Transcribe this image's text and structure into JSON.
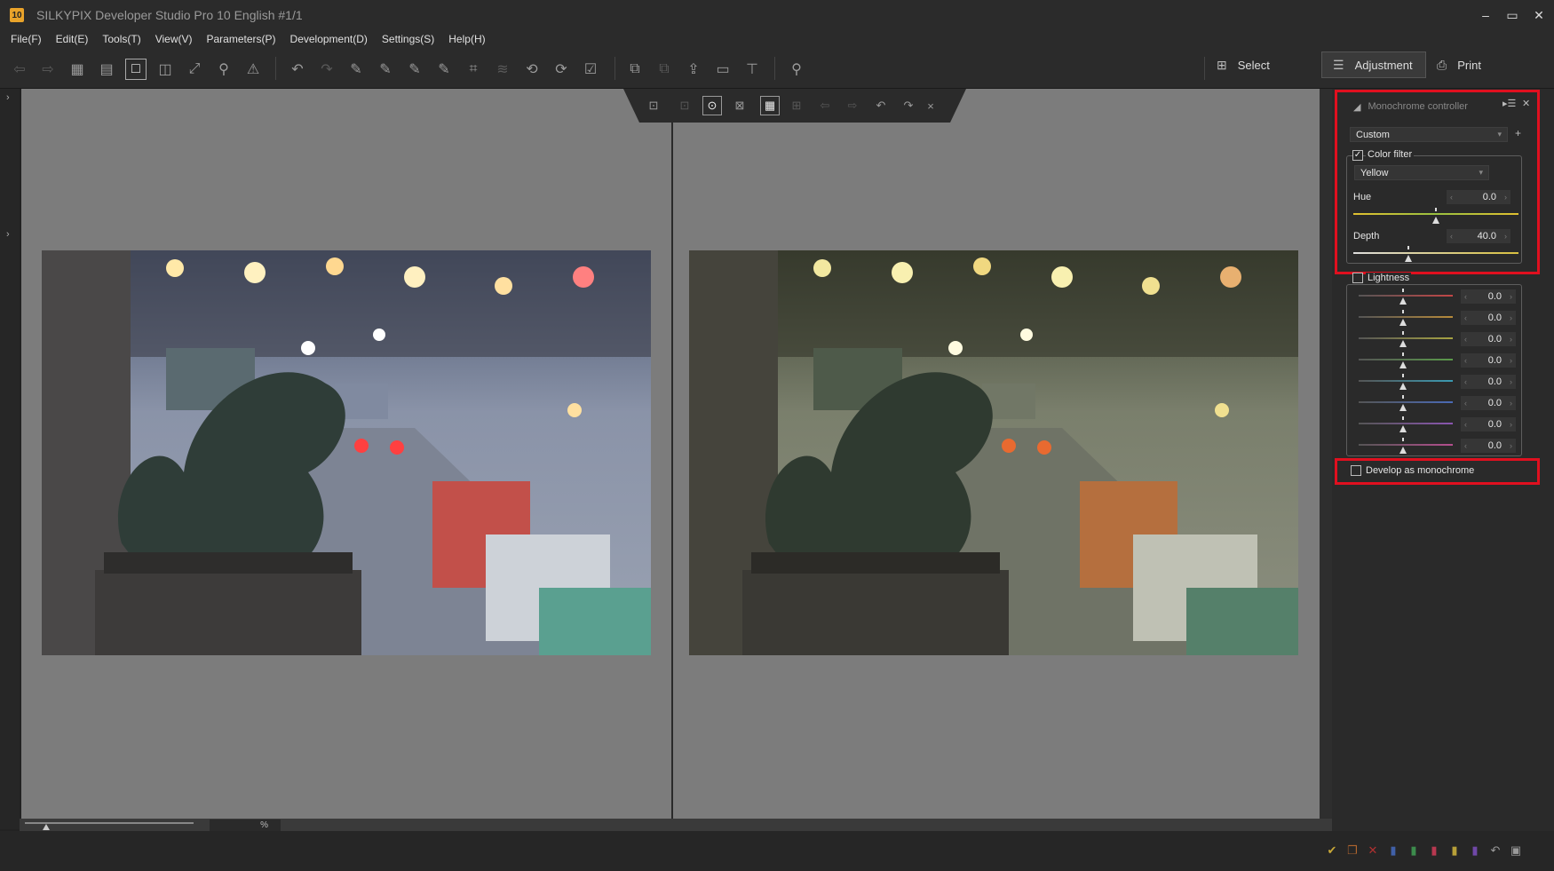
{
  "app": {
    "icon_text": "10",
    "title": "SILKYPIX Developer Studio Pro 10 English   #1/1"
  },
  "window_controls": {
    "minimize": "–",
    "maximize": "▭",
    "close": "✕"
  },
  "menu": [
    "File(F)",
    "Edit(E)",
    "Tools(T)",
    "View(V)",
    "Parameters(P)",
    "Development(D)",
    "Settings(S)",
    "Help(H)"
  ],
  "modes": {
    "select": "Select",
    "adjustment": "Adjustment",
    "print": "Print"
  },
  "zoom": {
    "value": "",
    "unit": "%"
  },
  "panel": {
    "title": "Monochrome controller",
    "preset": "Custom",
    "preset_add": "+",
    "color_filter": {
      "label": "Color filter",
      "checked": true,
      "color": "Yellow",
      "hue": {
        "label": "Hue",
        "value": "0.0"
      },
      "depth": {
        "label": "Depth",
        "value": "40.0"
      }
    },
    "lightness": {
      "label": "Lightness",
      "checked": false,
      "rows": [
        {
          "value": "0.0",
          "color": "#c24646"
        },
        {
          "value": "0.0",
          "color": "#b78a3a"
        },
        {
          "value": "0.0",
          "color": "#a7a342"
        },
        {
          "value": "0.0",
          "color": "#5a9a4a"
        },
        {
          "value": "0.0",
          "color": "#3a9ab2"
        },
        {
          "value": "0.0",
          "color": "#4a6ab6"
        },
        {
          "value": "0.0",
          "color": "#8a55b0"
        },
        {
          "value": "0.0",
          "color": "#b44e8e"
        }
      ]
    },
    "develop_mono": {
      "label": "Develop as monochrome",
      "checked": false
    }
  },
  "status_icons": [
    {
      "name": "check-icon",
      "glyph": "✔",
      "color": "#c8a838"
    },
    {
      "name": "copy-icon",
      "glyph": "❐",
      "color": "#b0652e"
    },
    {
      "name": "reject-icon",
      "glyph": "✕",
      "color": "#b03030"
    },
    {
      "name": "tag-blue-icon",
      "glyph": "▮",
      "color": "#4060a8"
    },
    {
      "name": "tag-green-icon",
      "glyph": "▮",
      "color": "#3c8c4c"
    },
    {
      "name": "tag-red-icon",
      "glyph": "▮",
      "color": "#b83850"
    },
    {
      "name": "tag-yellow-icon",
      "glyph": "▮",
      "color": "#b8a038"
    },
    {
      "name": "tag-purple-icon",
      "glyph": "▮",
      "color": "#7048a8"
    },
    {
      "name": "undo-icon",
      "glyph": "↶",
      "color": "#9a9a9a"
    },
    {
      "name": "lock-icon",
      "glyph": "▣",
      "color": "#9a9a9a"
    }
  ]
}
